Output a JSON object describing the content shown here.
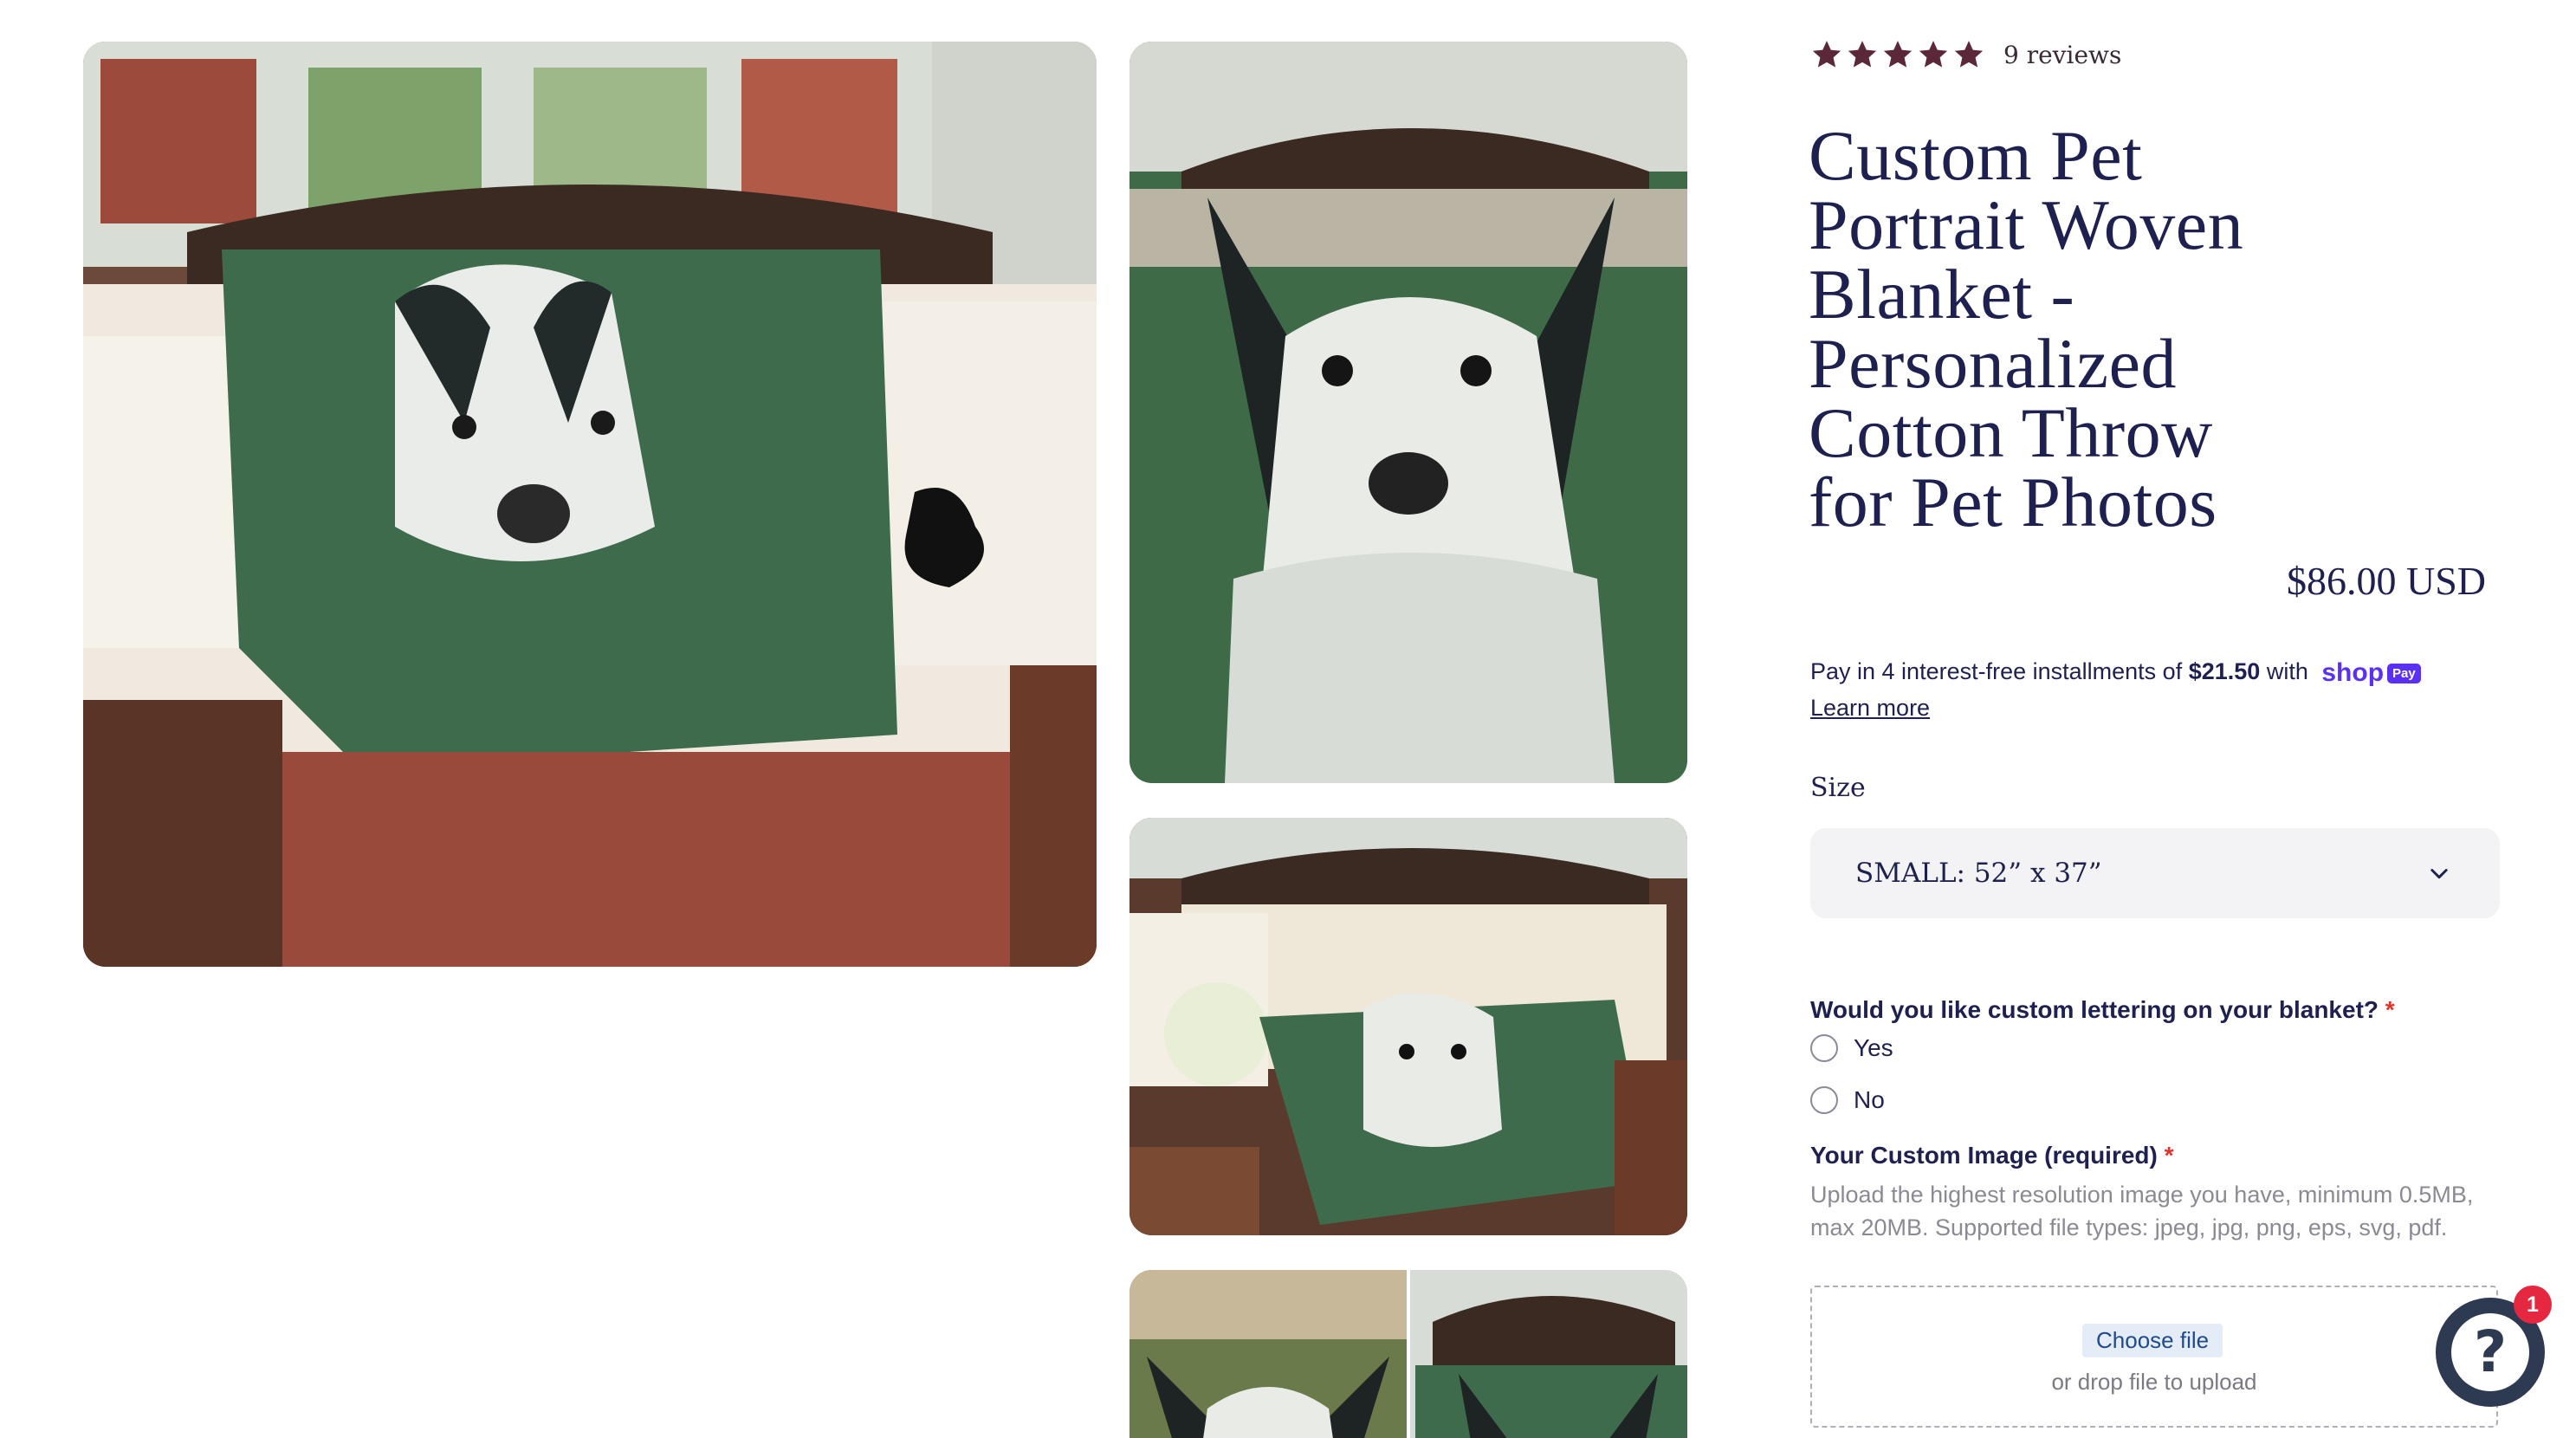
{
  "rating": {
    "stars": 5,
    "star_color": "#5a2838",
    "reviews_text": "9 reviews"
  },
  "product": {
    "title": "Custom Pet Portrait Woven Blanket - Personalized Cotton Throw for Pet Photos",
    "price": "$86.00 USD"
  },
  "installments": {
    "prefix": "Pay in 4 interest-free installments of",
    "amount": "$21.50",
    "suffix": "with",
    "shop_logo": "shop",
    "shop_pay_badge": "Pay",
    "learn_more": "Learn more"
  },
  "size": {
    "label": "Size",
    "selected": "SMALL: 52” x 37”"
  },
  "lettering": {
    "question": "Would you like custom lettering on your blanket?",
    "required_mark": "*",
    "options": [
      "Yes",
      "No"
    ]
  },
  "custom_image": {
    "label": "Your Custom Image (required)",
    "required_mark": "*",
    "help": "Upload the highest resolution image you have, minimum 0.5MB, max 20MB. Supported file types: jpeg, jpg, png, eps, svg, pdf.",
    "choose_button": "Choose file",
    "drop_text": "or drop file to upload"
  },
  "chat": {
    "icon": "question-icon",
    "badge_count": "1"
  },
  "gallery": {
    "images": [
      "blanket-on-sofa-photo",
      "husky-blanket-closeup-photo",
      "blanket-in-sunroom-photo",
      "husky-thumbnail-photo",
      "blanket-on-bench-photo"
    ]
  },
  "colors": {
    "text_primary": "#1e2150",
    "accent_shop": "#5a31f4",
    "required": "#e0342a",
    "badge": "#e5283f"
  }
}
